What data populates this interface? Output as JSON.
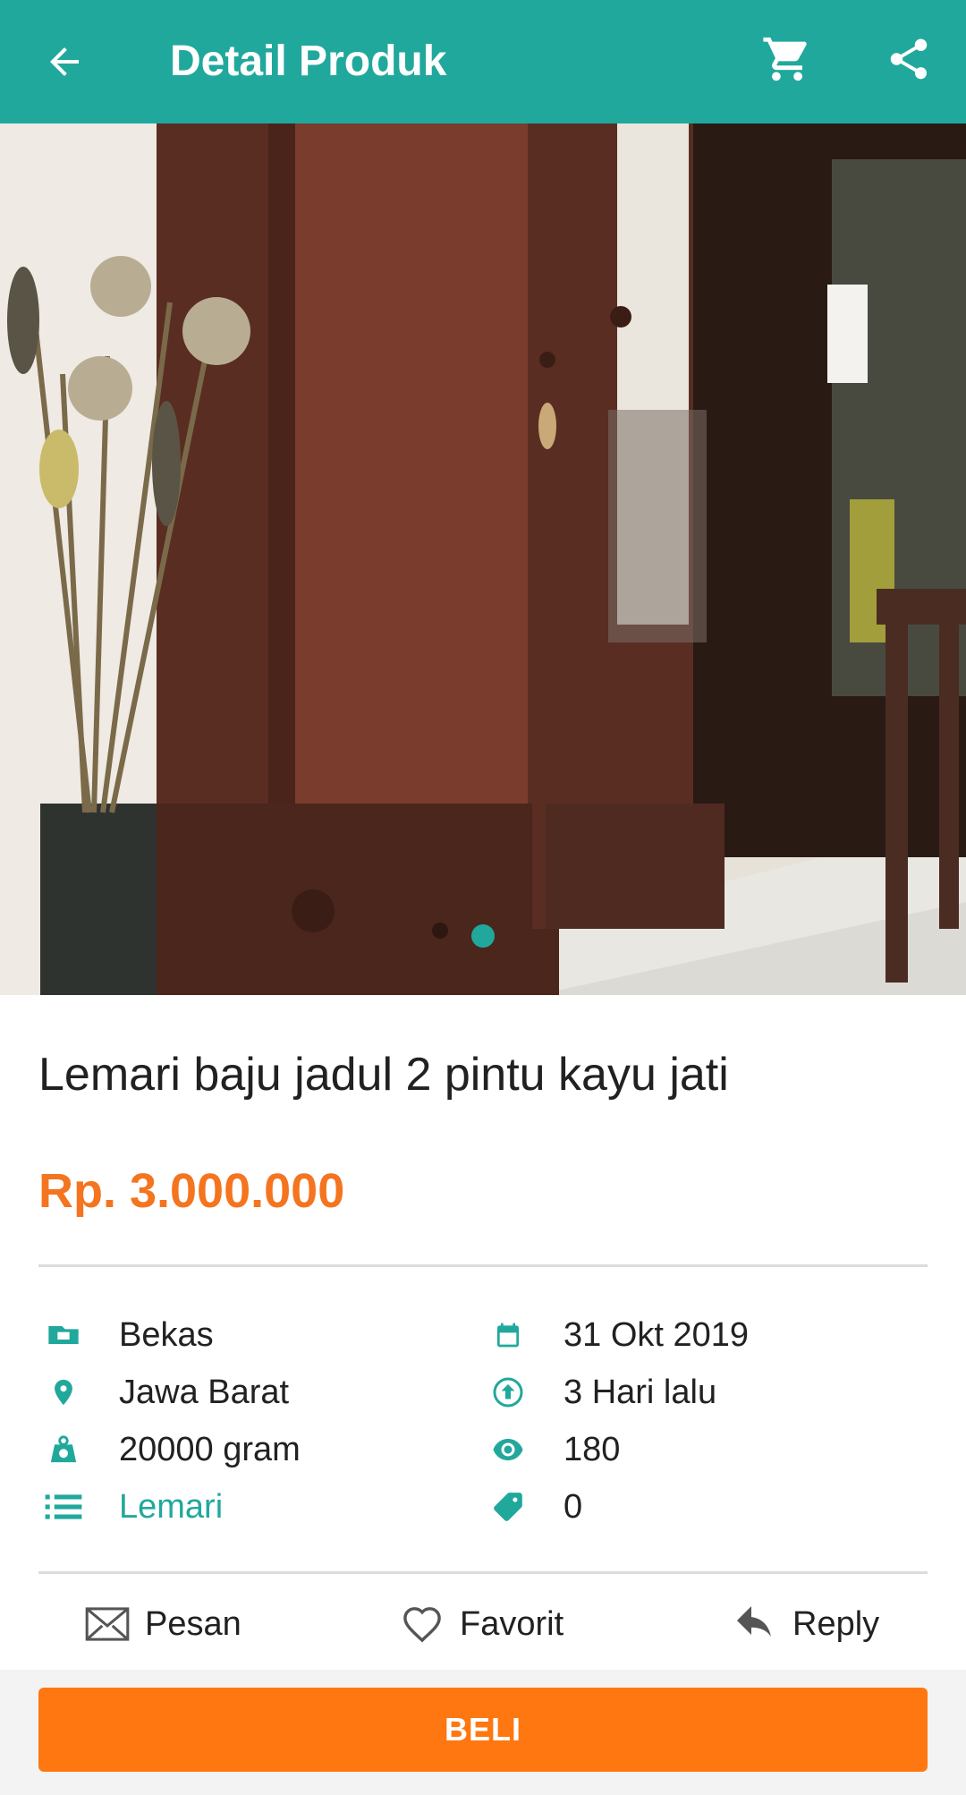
{
  "appbar": {
    "title": "Detail Produk",
    "back_icon": "arrow-left-icon",
    "cart_icon": "cart-icon",
    "share_icon": "share-icon"
  },
  "gallery": {
    "image_description": "wooden wardrobe photo",
    "page_count": 1,
    "active_page": 1
  },
  "product": {
    "title": "Lemari baju jadul 2 pintu kayu jati",
    "price": "Rp. 3.000.000"
  },
  "details": {
    "left": [
      {
        "icon": "condition-icon",
        "value": "Bekas"
      },
      {
        "icon": "location-pin-icon",
        "value": "Jawa Barat"
      },
      {
        "icon": "weight-icon",
        "value": "20000 gram"
      },
      {
        "icon": "category-list-icon",
        "value": "Lemari"
      }
    ],
    "right": [
      {
        "icon": "calendar-icon",
        "value": "31 Okt 2019"
      },
      {
        "icon": "upload-arrow-icon",
        "value": "3 Hari lalu"
      },
      {
        "icon": "eye-icon",
        "value": "180"
      },
      {
        "icon": "sold-tag-icon",
        "value": "0"
      }
    ]
  },
  "actions": {
    "message": "Pesan",
    "favorite": "Favorit",
    "reply": "Reply"
  },
  "buy_button": "BELI",
  "colors": {
    "primary": "#21a89c",
    "accent": "#f4741f",
    "buy": "#ff7710"
  }
}
